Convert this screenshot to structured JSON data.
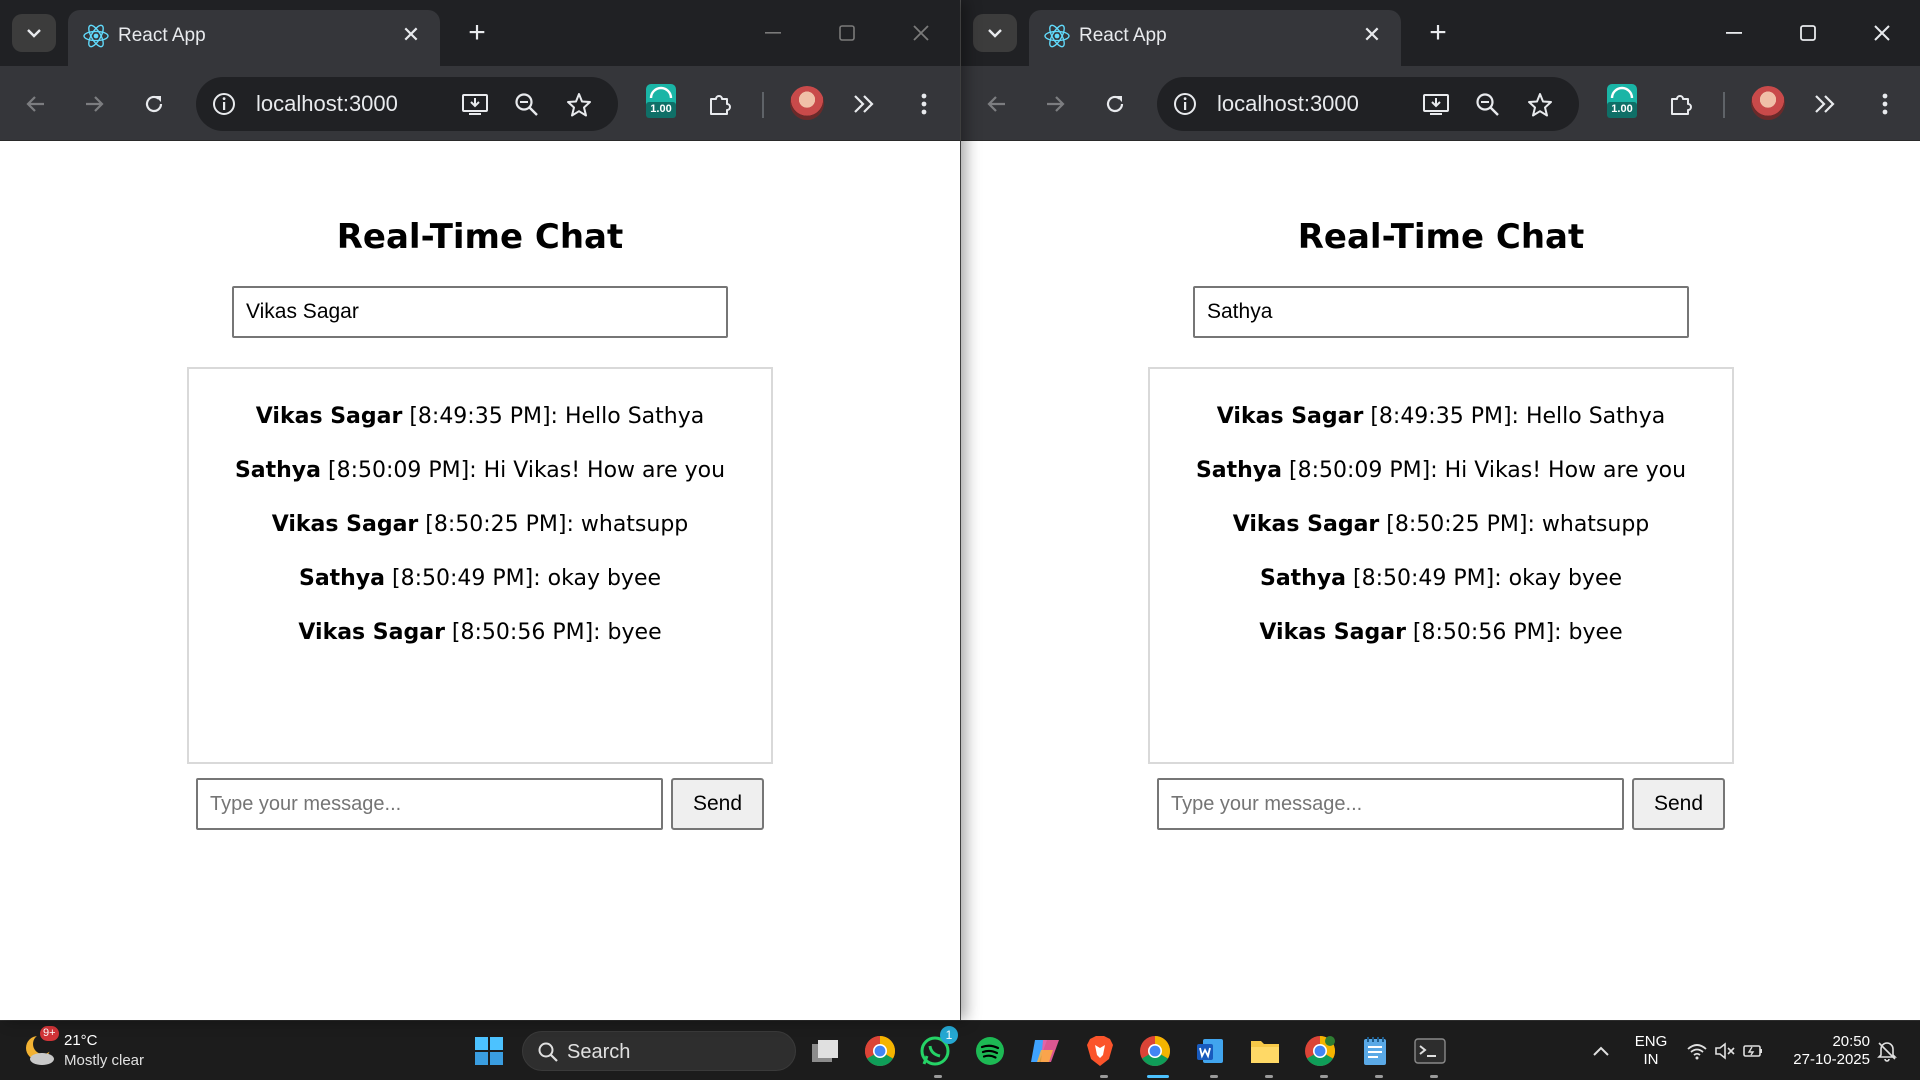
{
  "browser": {
    "tab_title": "React App",
    "url": "localhost:3000",
    "extension_badge": "1.00"
  },
  "left_window": {
    "app": {
      "title": "Real-Time Chat",
      "username_value": "Vikas Sagar",
      "messages": [
        {
          "user": "Vikas Sagar",
          "meta": " [8:49:35 PM]: Hello Sathya"
        },
        {
          "user": "Sathya",
          "meta": " [8:50:09 PM]: Hi Vikas! How are you"
        },
        {
          "user": "Vikas Sagar",
          "meta": " [8:50:25 PM]: whatsupp"
        },
        {
          "user": "Sathya",
          "meta": " [8:50:49 PM]: okay byee"
        },
        {
          "user": "Vikas Sagar",
          "meta": " [8:50:56 PM]: byee"
        }
      ],
      "message_placeholder": "Type your message...",
      "send_label": "Send"
    }
  },
  "right_window": {
    "app": {
      "title": "Real-Time Chat",
      "username_value": "Sathya",
      "messages": [
        {
          "user": "Vikas Sagar",
          "meta": " [8:49:35 PM]: Hello Sathya"
        },
        {
          "user": "Sathya",
          "meta": " [8:50:09 PM]: Hi Vikas! How are you"
        },
        {
          "user": "Vikas Sagar",
          "meta": " [8:50:25 PM]: whatsupp"
        },
        {
          "user": "Sathya",
          "meta": " [8:50:49 PM]: okay byee"
        },
        {
          "user": "Vikas Sagar",
          "meta": " [8:50:56 PM]: byee"
        }
      ],
      "message_placeholder": "Type your message...",
      "send_label": "Send"
    }
  },
  "taskbar": {
    "weather_badge": "9+",
    "weather_temp": "21°C",
    "weather_desc": "Mostly clear",
    "search_label": "Search",
    "whatsapp_badge": "1",
    "lang_line1": "ENG",
    "lang_line2": "IN",
    "time": "20:50",
    "date": "27-10-2025"
  },
  "colors": {
    "chrome_frame": "#202124",
    "chrome_toolbar": "#35363a",
    "taskbar": "#1c1c1c",
    "accent_teal": "#1ab5a6"
  }
}
